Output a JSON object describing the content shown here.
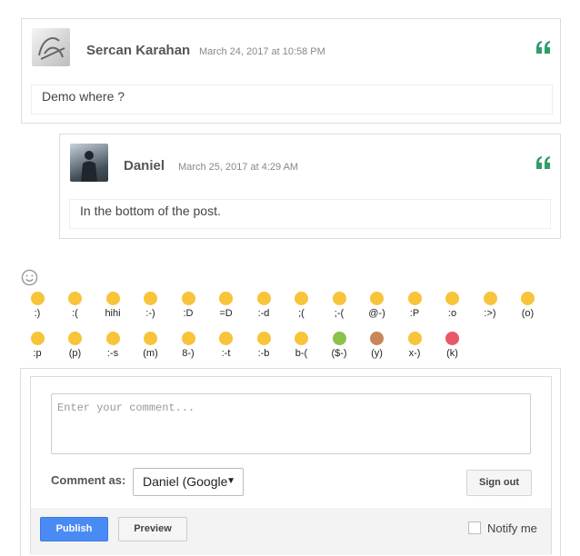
{
  "colors": {
    "accent_green": "#2e9e6b",
    "publish_blue": "#4a8af4"
  },
  "comments": [
    {
      "author": "Sercan Karahan",
      "date": "March 24, 2017 at 10:58 PM",
      "body": "Demo where ?",
      "icon": "quote-icon"
    },
    {
      "author": "Daniel",
      "date": "March 25, 2017 at 4:29 AM",
      "body": "In the bottom of the post.",
      "icon": "quote-icon"
    }
  ],
  "emoji_toggle_icon": "smiley-icon",
  "emojis": [
    {
      "code": ":)",
      "color": "#f7c43a"
    },
    {
      "code": ":(",
      "color": "#f7c43a"
    },
    {
      "code": "hihi",
      "color": "#f7c43a"
    },
    {
      "code": ":-)",
      "color": "#f7c43a"
    },
    {
      "code": ":D",
      "color": "#f7c43a"
    },
    {
      "code": "=D",
      "color": "#f7c43a"
    },
    {
      "code": ":-d",
      "color": "#f7c43a"
    },
    {
      "code": ";(",
      "color": "#f7c43a"
    },
    {
      "code": ";-(",
      "color": "#f7c43a"
    },
    {
      "code": "@-)",
      "color": "#f7c43a"
    },
    {
      "code": ":P",
      "color": "#f7c43a"
    },
    {
      "code": ":o",
      "color": "#f7c43a"
    },
    {
      "code": ":>)",
      "color": "#f7c43a"
    },
    {
      "code": "(o)",
      "color": "#f7c43a"
    },
    {
      "code": ":p",
      "color": "#f7c43a"
    },
    {
      "code": "(p)",
      "color": "#f7c43a"
    },
    {
      "code": ":-s",
      "color": "#f7c43a"
    },
    {
      "code": "(m)",
      "color": "#f7c43a"
    },
    {
      "code": "8-)",
      "color": "#f7c43a"
    },
    {
      "code": ":-t",
      "color": "#f7c43a"
    },
    {
      "code": ":-b",
      "color": "#f7c43a"
    },
    {
      "code": "b-(",
      "color": "#f7c43a"
    },
    {
      "code": "($-)",
      "color": "#8bc34a"
    },
    {
      "code": "(y)",
      "color": "#c8875a"
    },
    {
      "code": "x-)",
      "color": "#f7c43a"
    },
    {
      "code": "(k)",
      "color": "#e8586a"
    }
  ],
  "form": {
    "placeholder": "Enter your comment...",
    "comment_as_label": "Comment as:",
    "identity_selected": "Daniel (Google",
    "sign_out_label": "Sign out",
    "publish_label": "Publish",
    "preview_label": "Preview",
    "notify_label": "Notify me"
  }
}
